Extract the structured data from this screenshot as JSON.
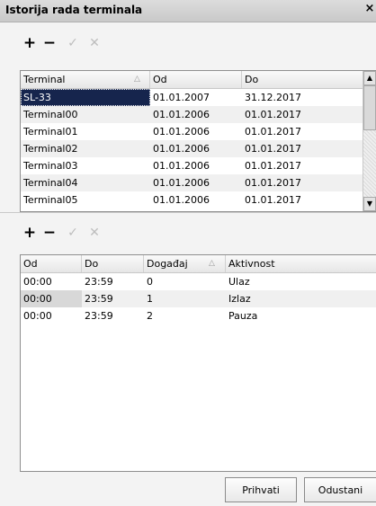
{
  "window": {
    "title": "Istorija rada terminala",
    "close": "×"
  },
  "toolbar_top": {
    "add": "+",
    "remove": "−",
    "confirm": "✓",
    "cancel": "✕"
  },
  "terminals": {
    "columns": [
      "Terminal",
      "Od",
      "Do"
    ],
    "sort_icon": "△",
    "rows": [
      [
        "SL-33",
        "01.01.2007",
        "31.12.2017"
      ],
      [
        "Terminal00",
        "01.01.2006",
        "01.01.2017"
      ],
      [
        "Terminal01",
        "01.01.2006",
        "01.01.2017"
      ],
      [
        "Terminal02",
        "01.01.2006",
        "01.01.2017"
      ],
      [
        "Terminal03",
        "01.01.2006",
        "01.01.2017"
      ],
      [
        "Terminal04",
        "01.01.2006",
        "01.01.2017"
      ],
      [
        "Terminal05",
        "01.01.2006",
        "01.01.2017"
      ]
    ],
    "selected_row": 0
  },
  "toolbar_bottom": {
    "add": "+",
    "remove": "−",
    "confirm": "✓",
    "cancel": "✕"
  },
  "events": {
    "columns": [
      "Od",
      "Do",
      "Događaj",
      "Aktivnost"
    ],
    "sort_icon": "△",
    "rows": [
      [
        "00:00",
        "23:59",
        "0",
        "Ulaz"
      ],
      [
        "00:00",
        "23:59",
        "1",
        "Izlaz"
      ],
      [
        "00:00",
        "23:59",
        "2",
        "Pauza"
      ]
    ]
  },
  "buttons": {
    "accept": "Prihvati",
    "cancel": "Odustani"
  }
}
